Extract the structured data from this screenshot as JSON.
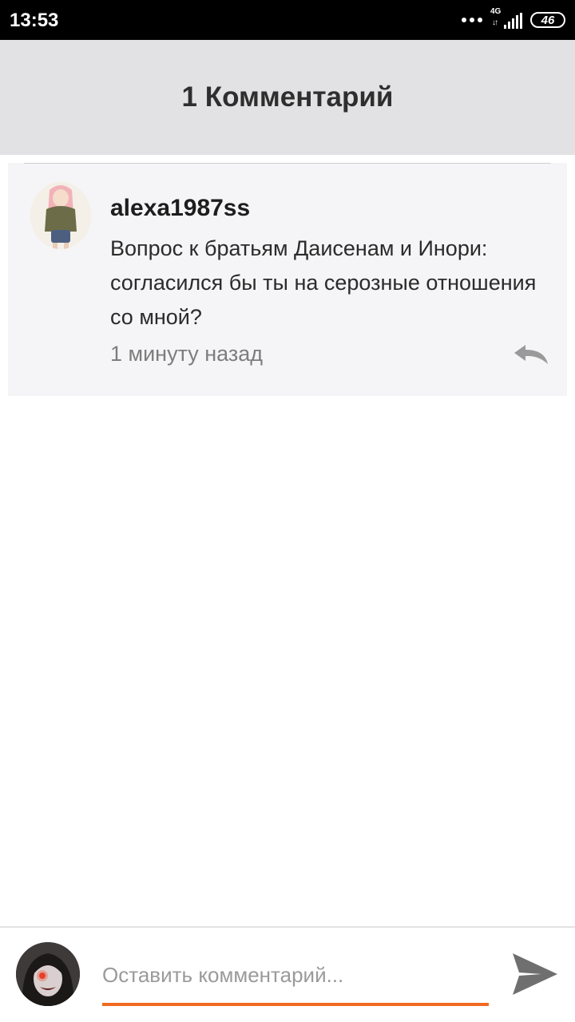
{
  "status_bar": {
    "time": "13:53",
    "network": "4G",
    "battery": "46",
    "icons": [
      "dots-icon",
      "data-arrows-icon",
      "signal-bars-icon",
      "battery-icon"
    ]
  },
  "header": {
    "title": "1 Комментарий",
    "background": "#e2e1e3"
  },
  "comments": [
    {
      "author": "alexa1987ss",
      "text": "Вопрос к братьям Даисенам и Инори: согласился бы ты на серозные отношения со мной?",
      "time": "1 минуту назад",
      "avatar": "anime-girl-avatar",
      "reply_icon": "reply-icon"
    }
  ],
  "composer": {
    "placeholder": "Оставить комментарий...",
    "value": "",
    "avatar": "user-avatar",
    "send_icon": "send-icon",
    "accent_color": "#f26a21"
  }
}
